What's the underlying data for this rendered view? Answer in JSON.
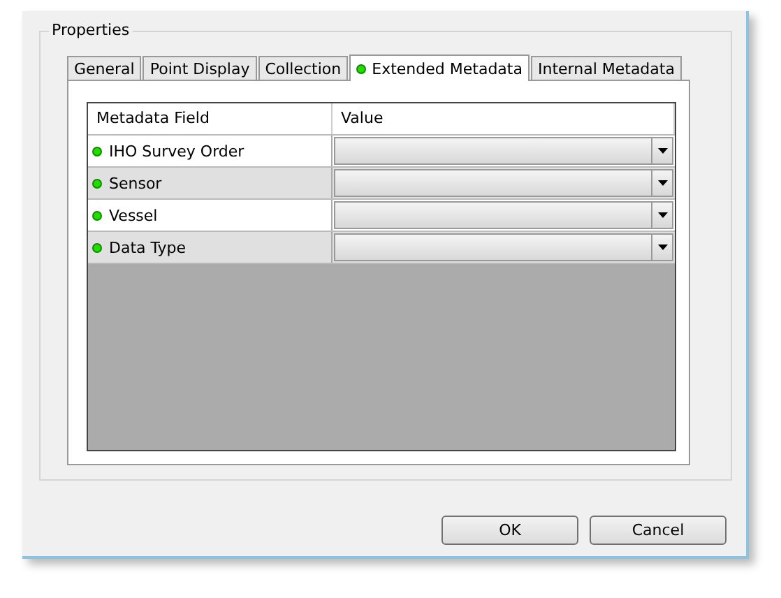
{
  "group": {
    "title": "Properties"
  },
  "tabs": [
    {
      "label": "General",
      "selected": false,
      "status_dot": false
    },
    {
      "label": "Point Display",
      "selected": false,
      "status_dot": false
    },
    {
      "label": "Collection",
      "selected": false,
      "status_dot": false
    },
    {
      "label": "Extended Metadata",
      "selected": true,
      "status_dot": true
    },
    {
      "label": "Internal Metadata",
      "selected": false,
      "status_dot": false
    }
  ],
  "table": {
    "columns": [
      "Metadata Field",
      "Value"
    ],
    "rows": [
      {
        "field": "IHO Survey Order"
      },
      {
        "field": "Sensor"
      },
      {
        "field": "Vessel"
      },
      {
        "field": "Data Type"
      }
    ]
  },
  "buttons": [
    "OK",
    "Cancel"
  ]
}
